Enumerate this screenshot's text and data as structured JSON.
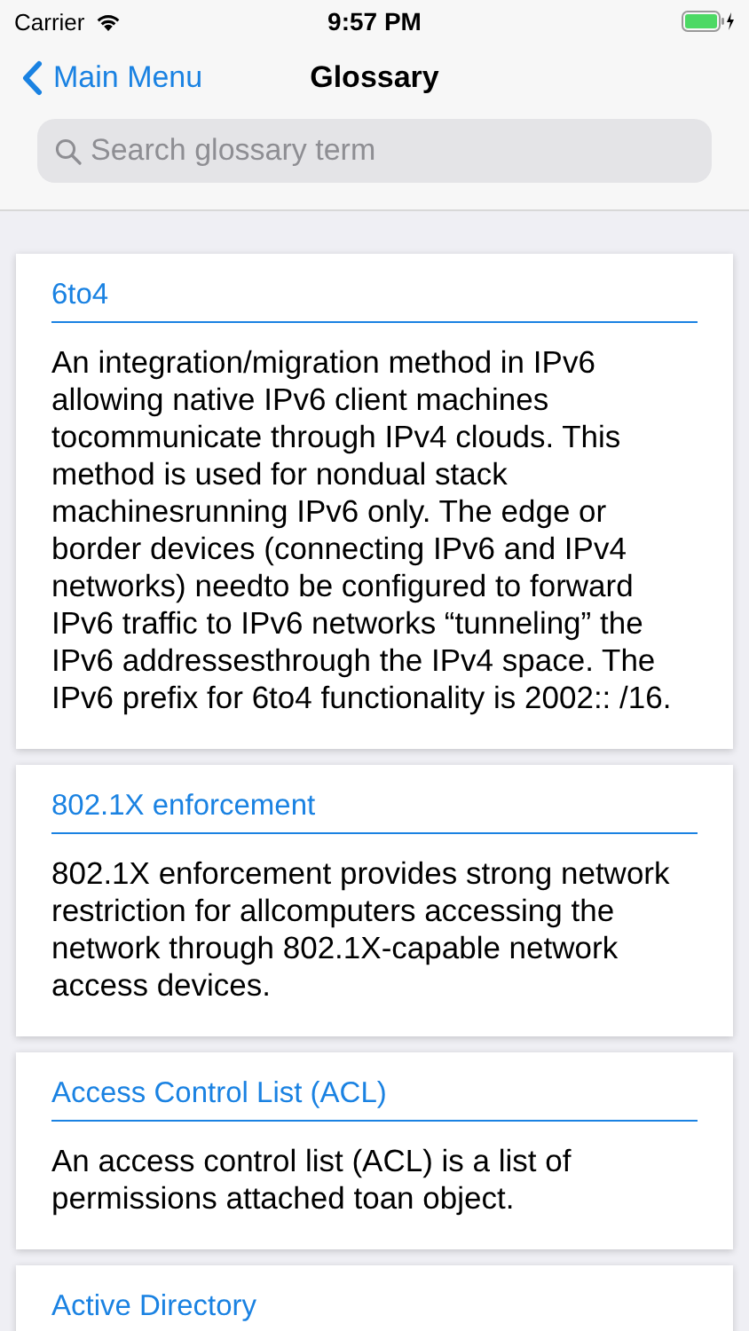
{
  "status_bar": {
    "carrier": "Carrier",
    "time": "9:57 PM"
  },
  "nav": {
    "back": "Main Menu",
    "title": "Glossary"
  },
  "search": {
    "placeholder": "Search glossary term"
  },
  "entries": [
    {
      "term": "6to4",
      "definition": "An integration/migration method in IPv6 allowing native IPv6 client machines tocommunicate through IPv4 clouds. This method is used for nondual stack machinesrunning IPv6 only. The edge or border devices (connecting IPv6 and IPv4 networks) needto be configured to forward IPv6 traffic to IPv6 networks “tunneling” the IPv6 addressesthrough the IPv4 space. The IPv6 prefix for 6to4 functionality is 2002:: /16."
    },
    {
      "term": "802.1X enforcement",
      "definition": "802.1X enforcement provides strong network restriction for allcomputers accessing the network through 802.1X-capable network access devices."
    },
    {
      "term": "Access Control List (ACL)",
      "definition": "An access control list (ACL) is a list of permissions attached toan object."
    },
    {
      "term": "Active Directory"
    }
  ]
}
